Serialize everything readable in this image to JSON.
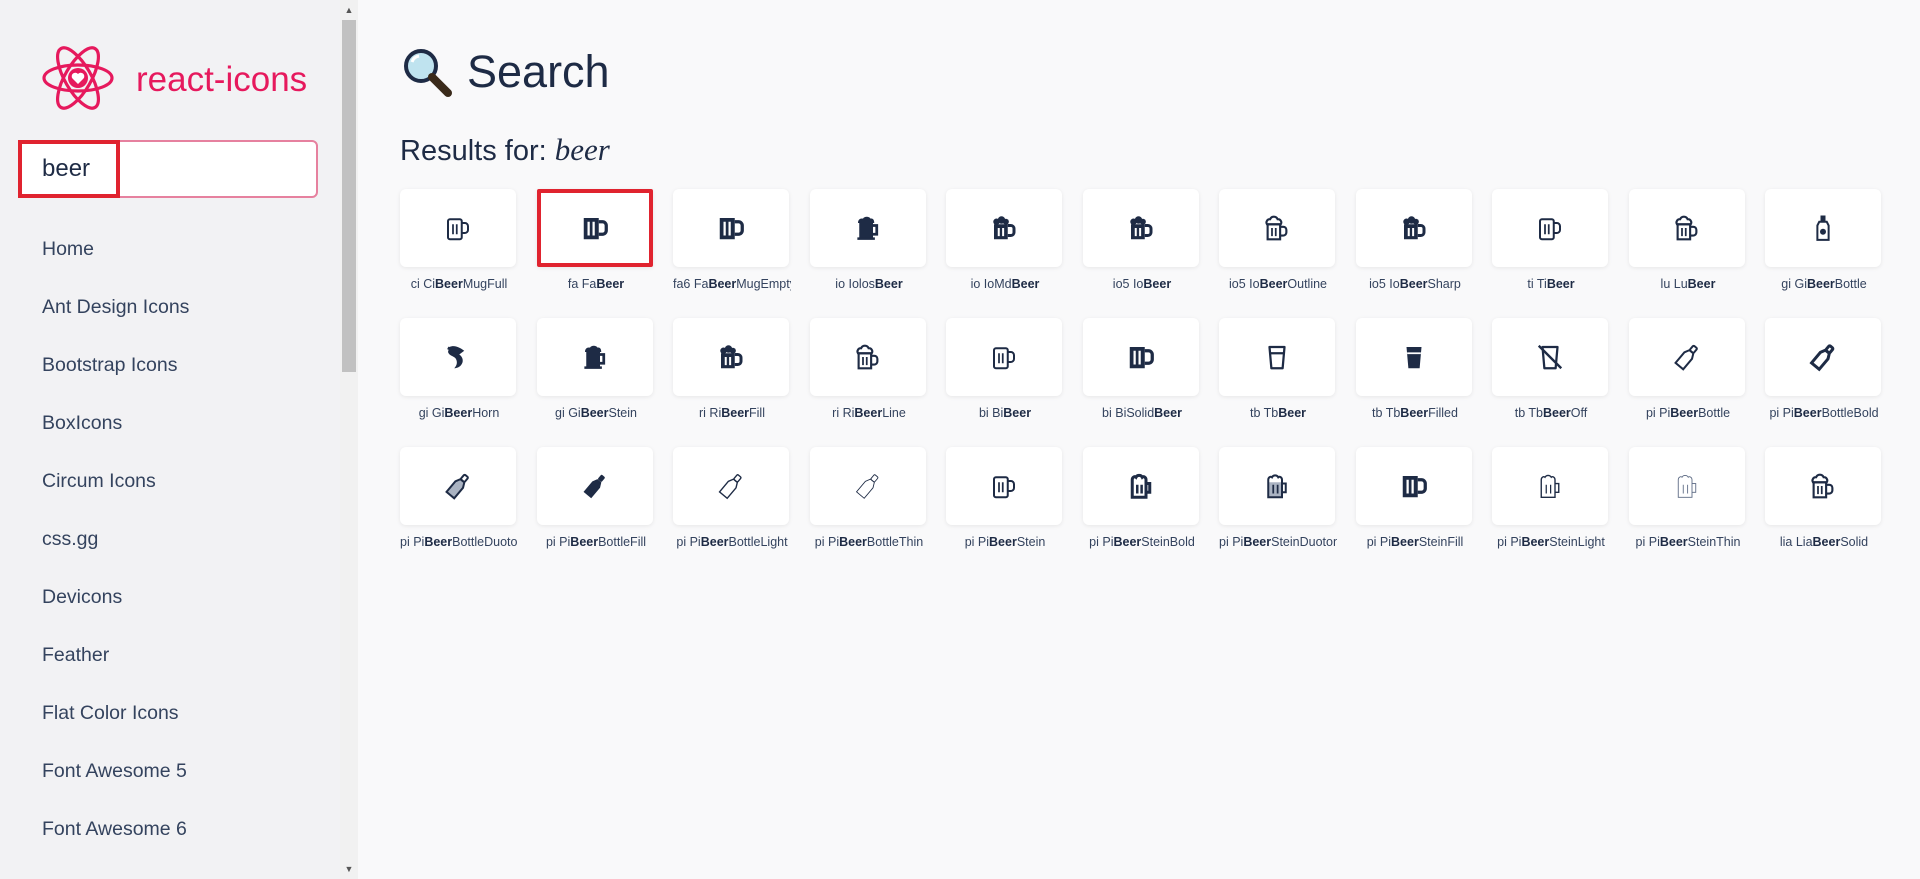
{
  "sidebar": {
    "brand": "react-icons",
    "search_value": "beer",
    "items": [
      {
        "label": "Home",
        "name": "home"
      },
      {
        "label": "Ant Design Icons",
        "name": "ant-design"
      },
      {
        "label": "Bootstrap Icons",
        "name": "bootstrap"
      },
      {
        "label": "BoxIcons",
        "name": "boxicons"
      },
      {
        "label": "Circum Icons",
        "name": "circum"
      },
      {
        "label": "css.gg",
        "name": "css-gg"
      },
      {
        "label": "Devicons",
        "name": "devicons"
      },
      {
        "label": "Feather",
        "name": "feather"
      },
      {
        "label": "Flat Color Icons",
        "name": "flat-color"
      },
      {
        "label": "Font Awesome 5",
        "name": "font-awesome-5"
      },
      {
        "label": "Font Awesome 6",
        "name": "font-awesome-6"
      }
    ]
  },
  "main": {
    "title": "Search",
    "results_prefix": "Results for:",
    "query": "beer",
    "icons": [
      {
        "p": "ci Ci",
        "b": "Beer",
        "s": "MugFull",
        "v": "mug-outline"
      },
      {
        "p": "fa Fa",
        "b": "Beer",
        "s": "",
        "v": "mug-bars",
        "selected": true
      },
      {
        "p": "fa6 Fa",
        "b": "Beer",
        "s": "MugEmpty",
        "v": "mug-bars"
      },
      {
        "p": "io Iolos",
        "b": "Beer",
        "s": "",
        "v": "stein"
      },
      {
        "p": "io IoMd",
        "b": "Beer",
        "s": "",
        "v": "mug-foam"
      },
      {
        "p": "io5 Io",
        "b": "Beer",
        "s": "",
        "v": "mug-foam"
      },
      {
        "p": "io5 Io",
        "b": "Beer",
        "s": "Outline",
        "v": "mug-foam-outline"
      },
      {
        "p": "io5 Io",
        "b": "Beer",
        "s": "Sharp",
        "v": "mug-foam"
      },
      {
        "p": "ti Ti",
        "b": "Beer",
        "s": "",
        "v": "mug-outline"
      },
      {
        "p": "lu Lu",
        "b": "Beer",
        "s": "",
        "v": "mug-foam-outline"
      },
      {
        "p": "gi Gi",
        "b": "Beer",
        "s": "Bottle",
        "v": "bottle-upright"
      },
      {
        "p": "gi Gi",
        "b": "Beer",
        "s": "Horn",
        "v": "horn"
      },
      {
        "p": "gi Gi",
        "b": "Beer",
        "s": "Stein",
        "v": "stein"
      },
      {
        "p": "ri Ri",
        "b": "Beer",
        "s": "Fill",
        "v": "mug-foam"
      },
      {
        "p": "ri Ri",
        "b": "Beer",
        "s": "Line",
        "v": "mug-foam-outline"
      },
      {
        "p": "bi Bi",
        "b": "Beer",
        "s": "",
        "v": "mug-outline"
      },
      {
        "p": "bi BiSolid",
        "b": "Beer",
        "s": "",
        "v": "mug-bars"
      },
      {
        "p": "tb Tb",
        "b": "Beer",
        "s": "",
        "v": "glass-outline"
      },
      {
        "p": "tb Tb",
        "b": "Beer",
        "s": "Filled",
        "v": "glass-filled"
      },
      {
        "p": "tb Tb",
        "b": "Beer",
        "s": "Off",
        "v": "glass-off"
      },
      {
        "p": "pi Pi",
        "b": "Beer",
        "s": "Bottle",
        "v": "bottle-outline"
      },
      {
        "p": "pi Pi",
        "b": "Beer",
        "s": "BottleBold",
        "v": "bottle-bold"
      },
      {
        "p": "pi Pi",
        "b": "Beer",
        "s": "BottleDuotone",
        "v": "bottle-duo"
      },
      {
        "p": "pi Pi",
        "b": "Beer",
        "s": "BottleFill",
        "v": "bottle-fill"
      },
      {
        "p": "pi Pi",
        "b": "Beer",
        "s": "BottleLight",
        "v": "bottle-light"
      },
      {
        "p": "pi Pi",
        "b": "Beer",
        "s": "BottleThin",
        "v": "bottle-thin"
      },
      {
        "p": "pi Pi",
        "b": "Beer",
        "s": "Stein",
        "v": "mug-outline"
      },
      {
        "p": "pi Pi",
        "b": "Beer",
        "s": "SteinBold",
        "v": "mug-bold"
      },
      {
        "p": "pi Pi",
        "b": "Beer",
        "s": "SteinDuotone",
        "v": "mug-duo"
      },
      {
        "p": "pi Pi",
        "b": "Beer",
        "s": "SteinFill",
        "v": "mug-bars"
      },
      {
        "p": "pi Pi",
        "b": "Beer",
        "s": "SteinLight",
        "v": "mug-light"
      },
      {
        "p": "pi Pi",
        "b": "Beer",
        "s": "SteinThin",
        "v": "mug-thin"
      },
      {
        "p": "lia Lia",
        "b": "Beer",
        "s": "Solid",
        "v": "mug-foam-outline"
      }
    ]
  },
  "colors": {
    "brand": "#e6195d",
    "text": "#1e2b45",
    "highlight": "#e0232f"
  }
}
